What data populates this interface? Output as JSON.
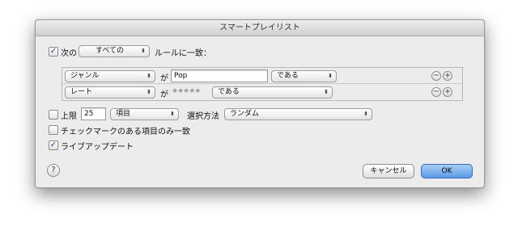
{
  "window": {
    "title": "スマートプレイリスト"
  },
  "match": {
    "checked": true,
    "check_mark": "✓",
    "prefix": "次の",
    "scope": "すべての",
    "suffix": "ルールに一致："
  },
  "rules": [
    {
      "field": "ジャンル",
      "conj": "が",
      "value": "Pop",
      "operator": "である"
    },
    {
      "field": "レート",
      "conj": "が",
      "stars": "★★★★★",
      "rating": 5,
      "operator": "である"
    }
  ],
  "rule_buttons": {
    "remove": "−",
    "add": "+"
  },
  "limit": {
    "checked": false,
    "label": "上限",
    "value": "25",
    "unit": "項目",
    "method_label": "選択方法",
    "method": "ランダム"
  },
  "checked_only": {
    "checked": false,
    "label": "チェックマークのある項目のみ一致"
  },
  "live_update": {
    "checked": true,
    "check_mark": "✓",
    "label": "ライブアップデート"
  },
  "buttons": {
    "help": "?",
    "cancel": "キャンセル",
    "ok": "OK"
  },
  "popup_arrow": "⬍"
}
